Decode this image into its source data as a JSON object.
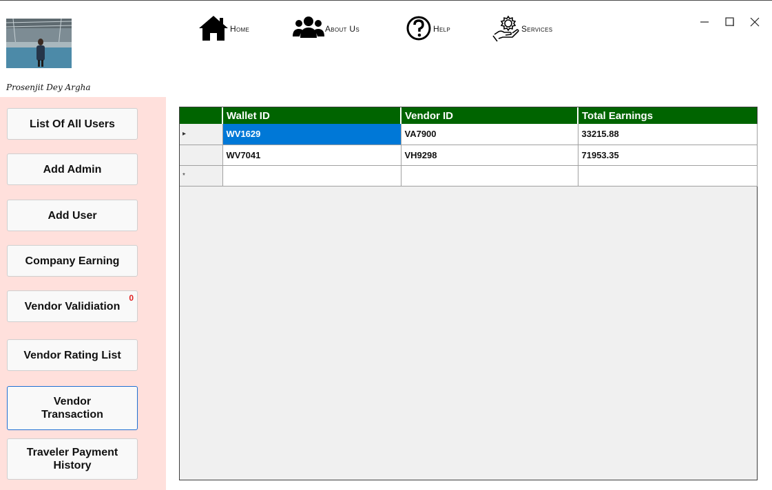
{
  "profile": {
    "name": "Prosenjit Dey Argha"
  },
  "nav": [
    {
      "label": "Home",
      "icon": "home-icon"
    },
    {
      "label": "About Us",
      "icon": "users-icon"
    },
    {
      "label": "Help",
      "icon": "help-icon"
    },
    {
      "label": "Services",
      "icon": "services-icon"
    }
  ],
  "window_controls": [
    "minimize",
    "maximize",
    "close"
  ],
  "sidebar": {
    "items": [
      {
        "label": "List Of All Users"
      },
      {
        "label": "Add Admin"
      },
      {
        "label": "Add User"
      },
      {
        "label": "Company Earning"
      },
      {
        "label": "Vendor Validiation",
        "badge": "0"
      },
      {
        "label": "Vendor Rating List"
      },
      {
        "label": "Vendor Transaction",
        "active": true
      },
      {
        "label": "Traveler Payment History"
      }
    ]
  },
  "grid": {
    "columns": [
      "Wallet ID",
      "Vendor ID",
      "Total Earnings"
    ],
    "rows": [
      {
        "row_marker": "▸",
        "cells": [
          "WV1629",
          "VA7900",
          "33215.88"
        ],
        "selected": true
      },
      {
        "row_marker": "",
        "cells": [
          "WV7041",
          "VH9298",
          "71953.35"
        ]
      }
    ],
    "new_row_marker": "*"
  },
  "colors": {
    "accent": "#006400",
    "selection": "#0078d7",
    "sidebar_bg": "#ffe0dc",
    "badge": "#e02020"
  }
}
